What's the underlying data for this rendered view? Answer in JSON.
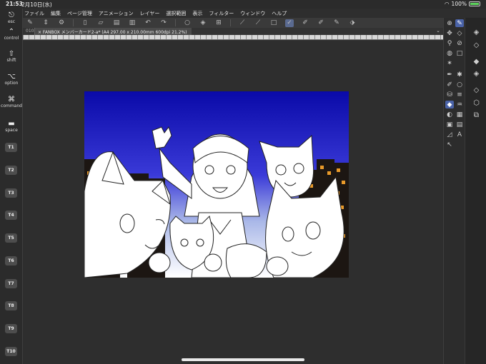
{
  "status": {
    "time": "21:53",
    "date": "2月10日(水)",
    "battery": "100%"
  },
  "menu": [
    "ファイル",
    "編集",
    "ページ管理",
    "アニメーション",
    "レイヤー",
    "選択範囲",
    "表示",
    "フィルター",
    "ウィンドウ",
    "ヘルプ"
  ],
  "tabs": {
    "tab1": "0104",
    "tab2": "× FANBOX メンバーカード2-a* (A4 297.00 x 210.00mm 600dpi 21.2%)"
  },
  "keys": {
    "esc": "esc",
    "control": "control",
    "shift": "shift",
    "option": "option",
    "command": "command",
    "space": "space",
    "t": [
      "T1",
      "T2",
      "T3",
      "T4",
      "T5",
      "T6",
      "T7",
      "T8",
      "T9",
      "T10"
    ]
  },
  "toolbar_icons": [
    "brush-icon",
    "updown-icon",
    "settings-icon",
    "new-icon",
    "open-icon",
    "save-icon",
    "print-icon",
    "undo-icon",
    "redo-icon",
    "rotate-icon",
    "fill-icon",
    "transform-icon",
    "pen-icon",
    "pen2-icon",
    "pen3-icon",
    "pen4-icon",
    "pen5-icon",
    "pencil-icon",
    "brush2-icon",
    "tag-icon"
  ],
  "colors": {
    "accent": "#4a63a8",
    "sky_top": "#0a0aa8",
    "sky_bottom": "#aab8e8"
  }
}
